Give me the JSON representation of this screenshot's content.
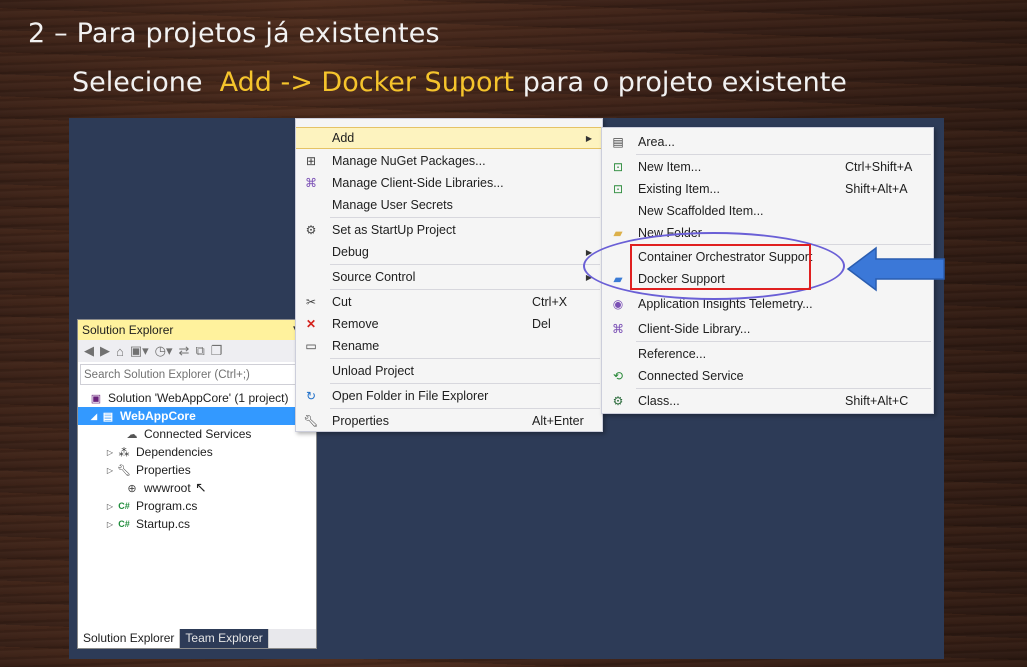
{
  "slide": {
    "title": "2 – Para projetos já existentes",
    "subtitle_prefix": "Selecione",
    "subtitle_highlight": "Add -> Docker Suport",
    "subtitle_suffix": " para o projeto existente",
    "highlight_color": "#f5c42c"
  },
  "solution_explorer": {
    "title": "Solution Explorer",
    "search_placeholder": "Search Solution Explorer (Ctrl+;)",
    "tree": [
      {
        "label": "Solution 'WebAppCore' (1 project)",
        "icon": "solution-icon"
      },
      {
        "label": "WebAppCore",
        "icon": "project-icon",
        "selected": true
      },
      {
        "label": "Connected Services",
        "icon": "connected-services-icon"
      },
      {
        "label": "Dependencies",
        "icon": "dependencies-icon"
      },
      {
        "label": "Properties",
        "icon": "wrench-icon"
      },
      {
        "label": "wwwroot",
        "icon": "globe-icon"
      },
      {
        "label": "Program.cs",
        "icon": "csharp-file-icon"
      },
      {
        "label": "Startup.cs",
        "icon": "csharp-file-icon"
      }
    ],
    "tabs": [
      "Solution Explorer",
      "Team Explorer"
    ]
  },
  "context_menu": {
    "items": [
      {
        "label": "Add",
        "has_submenu": true
      },
      {
        "label": "Manage NuGet Packages..."
      },
      {
        "label": "Manage Client-Side Libraries..."
      },
      {
        "label": "Manage User Secrets"
      },
      {
        "label": "Set as StartUp Project"
      },
      {
        "label": "Debug",
        "has_submenu": true
      },
      {
        "label": "Source Control",
        "has_submenu": true
      },
      {
        "label": "Cut",
        "shortcut": "Ctrl+X"
      },
      {
        "label": "Remove",
        "shortcut": "Del"
      },
      {
        "label": "Rename"
      },
      {
        "label": "Unload Project"
      },
      {
        "label": "Open Folder in File Explorer"
      },
      {
        "label": "Properties",
        "shortcut": "Alt+Enter"
      }
    ]
  },
  "add_submenu": {
    "items": [
      {
        "label": "Area..."
      },
      {
        "label": "New Item...",
        "shortcut": "Ctrl+Shift+A"
      },
      {
        "label": "Existing Item...",
        "shortcut": "Shift+Alt+A"
      },
      {
        "label": "New Scaffolded Item..."
      },
      {
        "label": "New Folder"
      },
      {
        "label": "Container Orchestrator Support"
      },
      {
        "label": "Docker Support"
      },
      {
        "label": "Application Insights Telemetry..."
      },
      {
        "label": "Client-Side Library..."
      },
      {
        "label": "Reference..."
      },
      {
        "label": "Connected Service"
      },
      {
        "label": "Class...",
        "shortcut": "Shift+Alt+C"
      }
    ]
  },
  "annotations": {
    "arrow_color": "#3b78d8",
    "box_color": "#e02020",
    "ellipse_color": "#6a5fd6"
  }
}
